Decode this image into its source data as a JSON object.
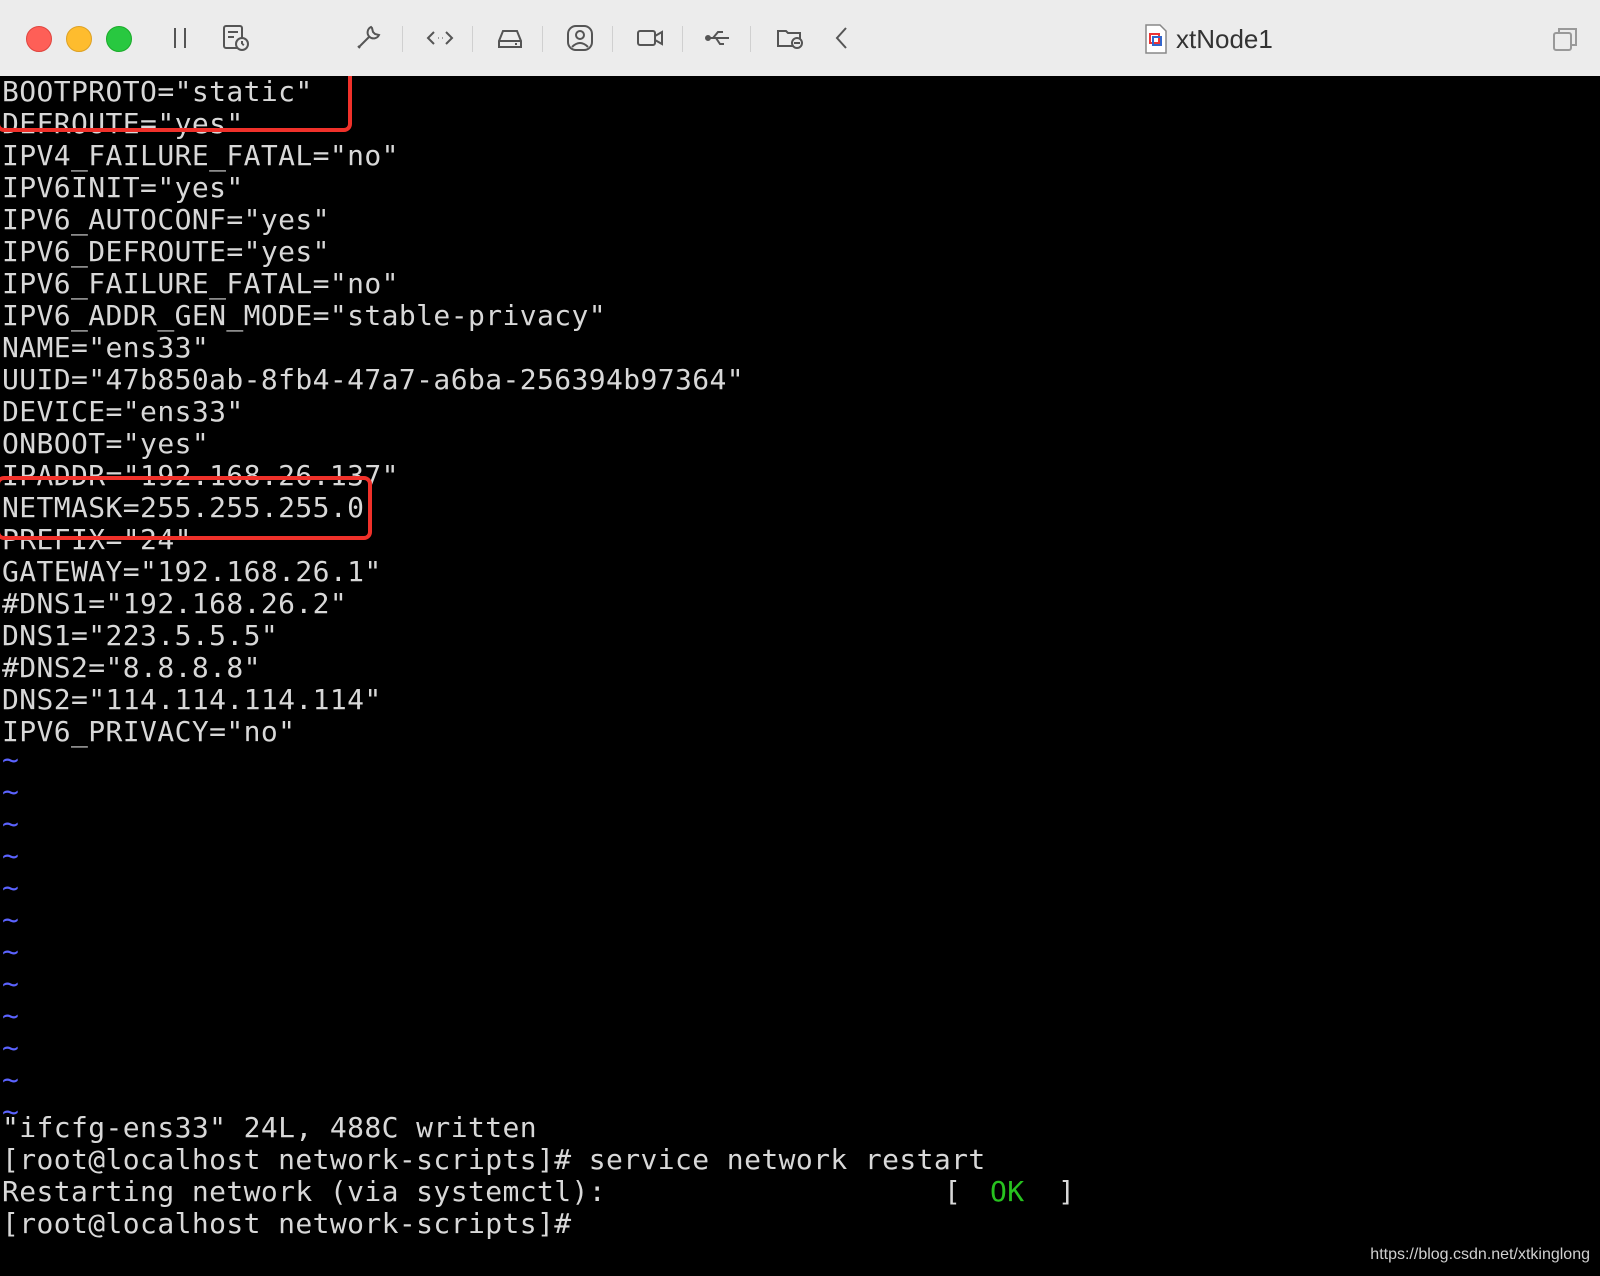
{
  "window": {
    "title": "xtNode1"
  },
  "toolbar": {
    "icons": [
      "pause-icon",
      "snapshot-icon",
      "settings-wrench-icon",
      "code-icon",
      "disk-drive-icon",
      "user-account-icon",
      "camera-icon",
      "usb-icon",
      "shared-folder-icon",
      "back-chevron-icon"
    ],
    "right_icon": "restore-window-icon"
  },
  "terminal": {
    "lines": [
      "BOOTPROTO=\"static\"",
      "DEFROUTE=\"yes\"",
      "IPV4_FAILURE_FATAL=\"no\"",
      "IPV6INIT=\"yes\"",
      "IPV6_AUTOCONF=\"yes\"",
      "IPV6_DEFROUTE=\"yes\"",
      "IPV6_FAILURE_FATAL=\"no\"",
      "IPV6_ADDR_GEN_MODE=\"stable-privacy\"",
      "NAME=\"ens33\"",
      "UUID=\"47b850ab-8fb4-47a7-a6ba-256394b97364\"",
      "DEVICE=\"ens33\"",
      "ONBOOT=\"yes\"",
      "IPADDR=\"192.168.26.137\"",
      "NETMASK=255.255.255.0",
      "PREFIX=\"24\"",
      "GATEWAY=\"192.168.26.1\"",
      "#DNS1=\"192.168.26.2\"",
      "DNS1=\"223.5.5.5\"",
      "#DNS2=\"8.8.8.8\"",
      "DNS2=\"114.114.114.114\"",
      "IPV6_PRIVACY=\"no\""
    ],
    "tilde": "~",
    "status_line": "\"ifcfg-ens33\" 24L, 488C written",
    "prompt_command": "[root@localhost network-scripts]# service network restart",
    "restart_text": "Restarting network (via systemctl):",
    "ok_open": "[",
    "ok_text": "OK",
    "ok_close": "]",
    "prompt_final": "[root@localhost network-scripts]#"
  },
  "watermark": "https://blog.csdn.net/xtkinglong",
  "colors": {
    "highlight": "#f0312a",
    "ok": "#27c21f",
    "tilde": "#5b63ff"
  }
}
